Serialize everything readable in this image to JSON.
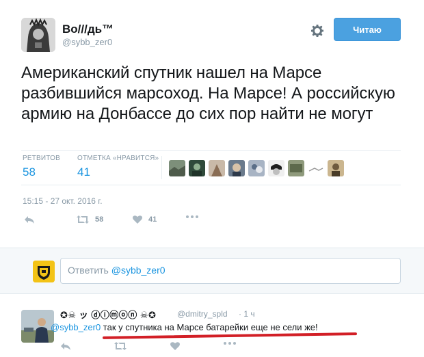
{
  "tweet": {
    "author_name": "Во///дь™",
    "author_handle": "@sybb_zer0",
    "follow_label": "Читаю",
    "text": "Американский спутник нашел на Марсе разбившийся марсоход. На Марсе! А российскую армию на Донбассе до сих пор найти не могут",
    "retweets_label": "РЕТВИТОВ",
    "retweets_count": "58",
    "likes_label": "ОТМЕТКА «НРАВИТСЯ»",
    "likes_count": "41",
    "timestamp": "15:15 - 27 окт. 2016 г.",
    "action_retweet_count": "58",
    "action_like_count": "41"
  },
  "reply": {
    "prompt": "Ответить ",
    "mention": "@sybb_zer0"
  },
  "comment": {
    "author_name": "✪☠ ッ ⓓⓘⓜⓞⓝ ☠✪",
    "author_handle": "@dmitry_spld",
    "time": "· 1 ч",
    "mention": "@sybb_zer0",
    "text": " так у спутника на Марсе батарейки еще не сели же!"
  },
  "colors": {
    "accent": "#1b95e0",
    "follow_button": "#4ba1e0",
    "muted": "#8899a6",
    "underline": "#d21f26"
  }
}
